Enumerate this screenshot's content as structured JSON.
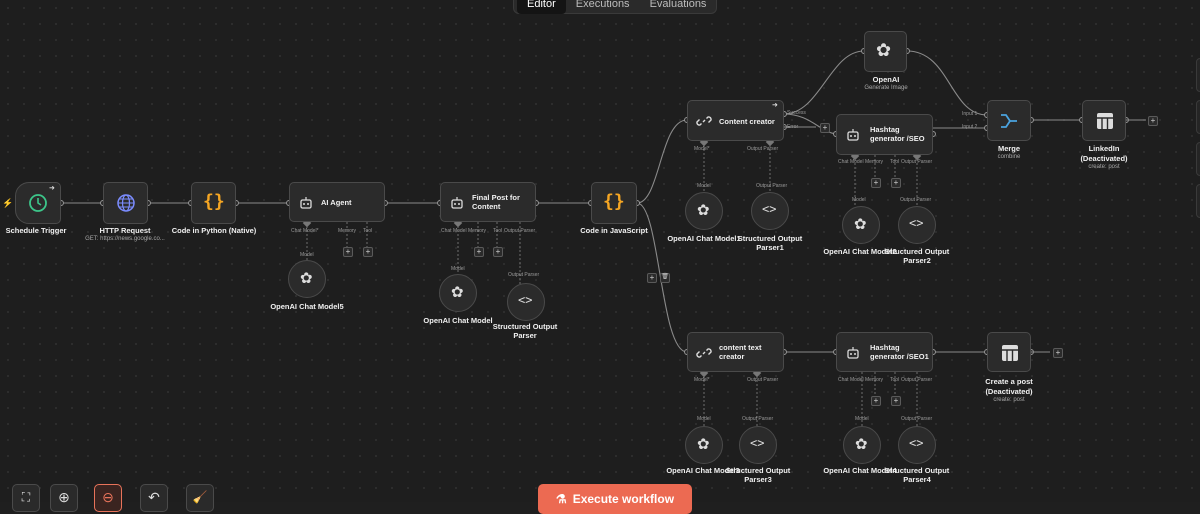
{
  "tabs": {
    "editor": "Editor",
    "executions": "Executions",
    "evaluations": "Evaluations"
  },
  "nodes": {
    "schedule": {
      "title": "Schedule Trigger"
    },
    "http": {
      "title": "HTTP Request",
      "sub": "GET: https://news.google.co..."
    },
    "python": {
      "title": "Code in Python (Native)"
    },
    "agent": {
      "title": "AI Agent",
      "p1": "Chat Model*",
      "p2": "Memory",
      "p3": "Tool"
    },
    "final": {
      "title1": "Final Post for",
      "title2": "Content",
      "p1": "Chat Model",
      "p2": "Memory",
      "p3": "Tool",
      "p4": "Output Parser"
    },
    "codejs": {
      "title": "Code in JavaScript"
    },
    "creator": {
      "title": "Content creator",
      "p1": "Model*",
      "p2": "Output Parser",
      "succ": "Success",
      "err": "Error"
    },
    "hashtag": {
      "title1": "Hashtag",
      "title2": "generator /SEO",
      "p1": "Chat Model",
      "p2": "Memory",
      "p3": "Tool",
      "p4": "Output Parser"
    },
    "openai": {
      "title": "OpenAI",
      "sub": "Generate Image"
    },
    "merge": {
      "title": "Merge",
      "sub": "combine",
      "in1": "Input 1",
      "in2": "Input 2"
    },
    "linkedin": {
      "title1": "LinkedIn",
      "title2": "(Deactivated)",
      "sub": "create: post"
    },
    "textcreator": {
      "title1": "content text",
      "title2": "creator",
      "p1": "Model*",
      "p2": "Output Parser"
    },
    "hashtag1": {
      "title1": "Hashtag",
      "title2": "generator /SEO1",
      "p1": "Chat Model",
      "p2": "Memory",
      "p3": "Tool",
      "p4": "Output Parser"
    },
    "createpost": {
      "title1": "Create a post",
      "title2": "(Deactivated)",
      "sub": "create: post"
    },
    "model5": {
      "title": "OpenAI Chat Model5",
      "port": "Model"
    },
    "modelA": {
      "title": "OpenAI Chat Model",
      "port": "Model"
    },
    "parserA": {
      "title1": "Structured Output",
      "title2": "Parser",
      "port": "Output Parser"
    },
    "model1": {
      "title": "OpenAI Chat Model1",
      "port": "Model"
    },
    "parser1": {
      "title1": "Structured Output",
      "title2": "Parser1",
      "port": "Output Parser"
    },
    "model2": {
      "title": "OpenAI Chat Model2",
      "port": "Model"
    },
    "parser2": {
      "title1": "Structured Output",
      "title2": "Parser2",
      "port": "Output Parser"
    },
    "model3": {
      "title": "OpenAI Chat Model3",
      "port": "Model"
    },
    "parser3": {
      "title1": "Structured Output",
      "title2": "Parser3",
      "port": "Output Parser"
    },
    "model4": {
      "title": "OpenAI Chat Model4",
      "port": "Model"
    },
    "parser4": {
      "title1": "Structured Output",
      "title2": "Parser4",
      "port": "Output Parser"
    }
  },
  "toolbar": {
    "execute": "Execute workflow",
    "fit": "fit-view-icon",
    "zoomin": "zoom-in-icon",
    "zoomout": "zoom-out-icon",
    "undo": "undo-icon",
    "clean": "tidy-up-icon"
  },
  "colors": {
    "accent": "#ec6a52",
    "node_bg": "#2b2b2b",
    "node_border": "#4a4a4a",
    "canvas": "#1e1e1e",
    "trigger_icon": "#3cc68a",
    "code_icon": "#f5a623",
    "http_icon": "#7b8cff"
  }
}
